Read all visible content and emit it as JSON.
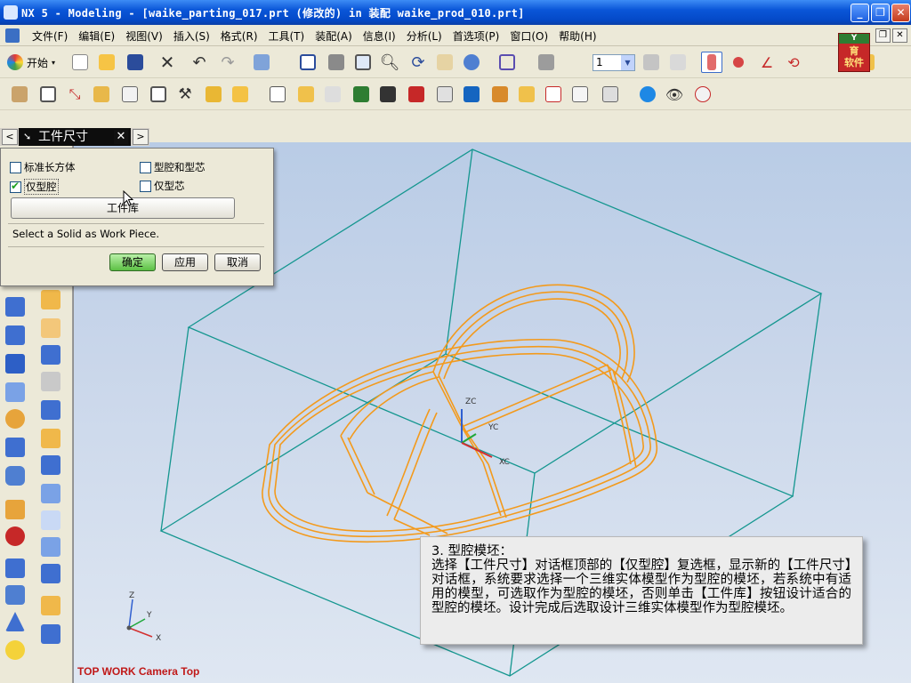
{
  "window": {
    "title": "NX 5 - Modeling - [waike_parting_017.prt (修改的) in 装配 waike_prod_010.prt]",
    "minimize": "_",
    "restore": "❐",
    "close": "✕"
  },
  "menu": {
    "items": [
      "文件(F)",
      "编辑(E)",
      "视图(V)",
      "插入(S)",
      "格式(R)",
      "工具(T)",
      "装配(A)",
      "信息(I)",
      "分析(L)",
      "首选项(P)",
      "窗口(O)",
      "帮助(H)"
    ]
  },
  "brand": {
    "line1": "Y",
    "line2": "育",
    "line3": "软件"
  },
  "toolbar": {
    "start_label": "开始",
    "layer_value": "1"
  },
  "dialog": {
    "title": "工件尺寸",
    "back": "<",
    "forward": ">",
    "close": "✕",
    "options": {
      "standard_block": "标准长方体",
      "cavity_and_core": "型腔和型芯",
      "cavity_only": "仅型腔",
      "core_only": "仅型芯"
    },
    "checked": {
      "standard_block": false,
      "cavity_and_core": false,
      "cavity_only": true,
      "core_only": false
    },
    "library_button": "工件库",
    "prompt": "Select a Solid as Work Piece.",
    "ok": "确定",
    "apply": "应用",
    "cancel": "取消"
  },
  "graphics": {
    "view_label": "TOP WORK Camera Top",
    "wcs": {
      "z": "ZC",
      "y": "YC",
      "x": "XC"
    },
    "absolute_triad": {
      "z": "Z",
      "y": "Y",
      "x": "X"
    },
    "colors": {
      "box": "#14968f",
      "part": "#f39a1c",
      "background": "#c9d6ea"
    }
  },
  "caption": {
    "heading": "3. 型腔模坯：",
    "body": "选择【工件尺寸】对话框顶部的【仅型腔】复选框，显示新的【工件尺寸】对话框，系统要求选择一个三维实体模型作为型腔的模坯，若系统中有适用的模型，可选取作为型腔的模坯，否则单击【工件库】按钮设计适合的型腔的模坯。设计完成后选取设计三维实体模型作为型腔模坯。"
  }
}
